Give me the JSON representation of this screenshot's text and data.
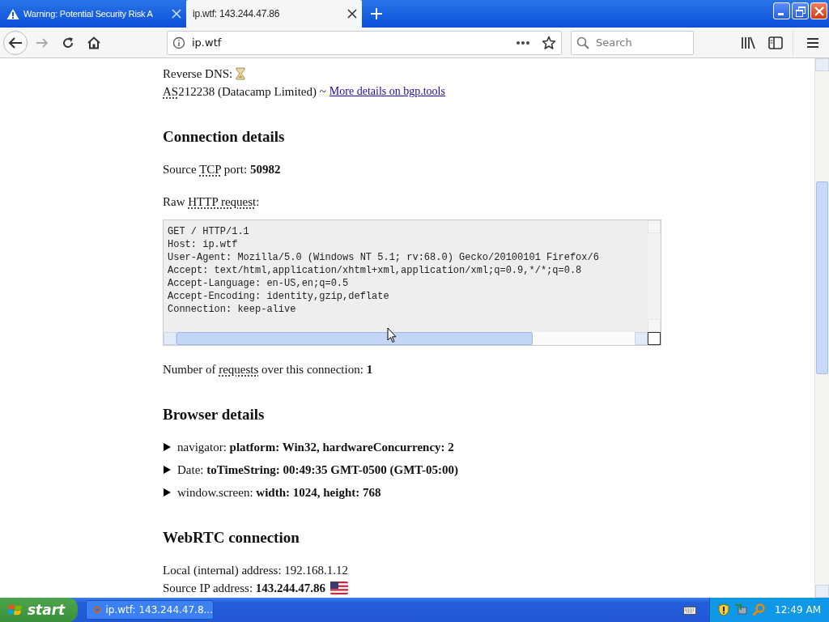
{
  "window": {
    "tabs": [
      {
        "title": "Warning: Potential Security Risk A",
        "selected": false
      },
      {
        "title": "ip.wtf: 143.244.47.86",
        "selected": true
      }
    ]
  },
  "toolbar": {
    "back_disabled": false,
    "forward_disabled": true,
    "url": "ip.wtf",
    "search": {
      "placeholder": "Search"
    }
  },
  "page": {
    "blocks": [
      {
        "kind": "line",
        "segments": [
          {
            "text": "Reverse DNS: "
          }
        ]
      },
      {
        "kind": "line",
        "segments": [
          {
            "text": "AS",
            "abbr": true
          },
          {
            "text": "212238 (Datacamp Limited) ~ "
          }
        ],
        "link": "More details on bgp.tools"
      },
      {
        "kind": "heading",
        "text": "Connection details"
      },
      {
        "kind": "line",
        "segments": [
          {
            "text": "Source "
          },
          {
            "text": "TCP",
            "abbr": true
          },
          {
            "text": " port: "
          },
          {
            "text": "50982",
            "bold": true
          }
        ]
      },
      {
        "kind": "line",
        "segments": [
          {
            "text": "Raw "
          },
          {
            "text": "HTTP request",
            "abbr": true
          },
          {
            "text": ":"
          }
        ]
      },
      {
        "kind": "code",
        "lines": [
          "GET / HTTP/1.1",
          "Host: ip.wtf",
          "User-Agent: Mozilla/5.0 (Windows NT 5.1; rv:68.0) Gecko/20100101 Firefox/6",
          "Accept: text/html,application/xhtml+xml,application/xml;q=0.9,*/*;q=0.8",
          "Accept-Language: en-US,en;q=0.5",
          "Accept-Encoding: identity,gzip,deflate",
          "Connection: keep-alive"
        ]
      },
      {
        "kind": "line",
        "segments": [
          {
            "text": "Number of "
          },
          {
            "text": "requests",
            "abbr": true
          },
          {
            "text": " over this connection: "
          },
          {
            "text": "1",
            "bold": true
          }
        ]
      },
      {
        "kind": "heading",
        "text": "Browser details"
      },
      {
        "kind": "details",
        "expanded": false,
        "text": "navigator: **platform: Win32, hardwareConcurrency: 2**"
      },
      {
        "kind": "details",
        "expanded": false,
        "text": "Date: **toTimeString: 00:49:35 GMT-0500 (GMT-05:00)**"
      },
      {
        "kind": "details",
        "expanded": false,
        "text": "window.screen: **width: 1024, height: 768**"
      },
      {
        "kind": "heading",
        "text": "WebRTC connection"
      },
      {
        "kind": "line",
        "segments": [
          {
            "text": "Local (internal) address: 192.168.1.12"
          }
        ]
      },
      {
        "kind": "line",
        "segments": [
          {
            "text": "Source IP address: "
          },
          {
            "text": "143.244.47.86",
            "bold": true
          }
        ]
      }
    ]
  },
  "taskbar": {
    "start": "start",
    "tasks": [
      {
        "title": "ip.wtf: 143.244.47.8...",
        "selected": false
      }
    ],
    "clock": "12:49 AM"
  }
}
